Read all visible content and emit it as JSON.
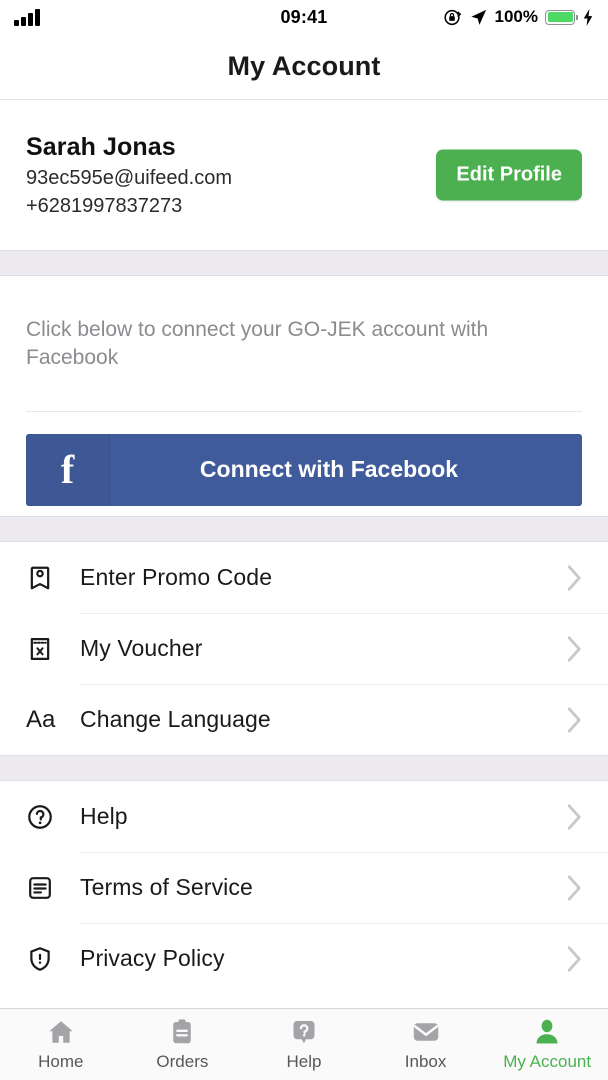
{
  "status_bar": {
    "time": "09:41",
    "battery_percent": "100%",
    "signal_icon": "signal-bars-icon",
    "rotation_lock_icon": "rotation-lock-icon",
    "location_icon": "location-arrow-icon",
    "battery_icon": "battery-icon",
    "charging_icon": "charging-bolt-icon",
    "battery_color": "#4CD964"
  },
  "navbar": {
    "title": "My Account"
  },
  "profile": {
    "name": "Sarah Jonas",
    "email": "93ec595e@uifeed.com",
    "phone": "+6281997837273",
    "edit_label": "Edit Profile",
    "edit_color": "#4CB050"
  },
  "facebook": {
    "description": "Click below to connect your GO-JEK account with Facebook",
    "button_label": "Connect with Facebook",
    "logo_glyph": "f",
    "logo_icon": "facebook-f-icon",
    "button_color": "#3f5b9b"
  },
  "menu_group_1": [
    {
      "label": "Enter Promo Code",
      "icon": "tag-icon"
    },
    {
      "label": "My Voucher",
      "icon": "voucher-ticket-icon"
    },
    {
      "label": "Change Language",
      "icon": "aa-text-icon",
      "glyph": "Aa"
    }
  ],
  "menu_group_2": [
    {
      "label": "Help",
      "icon": "question-circle-icon"
    },
    {
      "label": "Terms of Service",
      "icon": "document-icon"
    },
    {
      "label": "Privacy Policy",
      "icon": "shield-icon"
    }
  ],
  "tabbar": {
    "active_color": "#4CB050",
    "items": [
      {
        "label": "Home",
        "icon": "home-icon",
        "active": false
      },
      {
        "label": "Orders",
        "icon": "clipboard-icon",
        "active": false
      },
      {
        "label": "Help",
        "icon": "help-bubble-icon",
        "active": false
      },
      {
        "label": "Inbox",
        "icon": "envelope-icon",
        "active": false
      },
      {
        "label": "My Account",
        "icon": "person-icon",
        "active": true
      }
    ]
  }
}
